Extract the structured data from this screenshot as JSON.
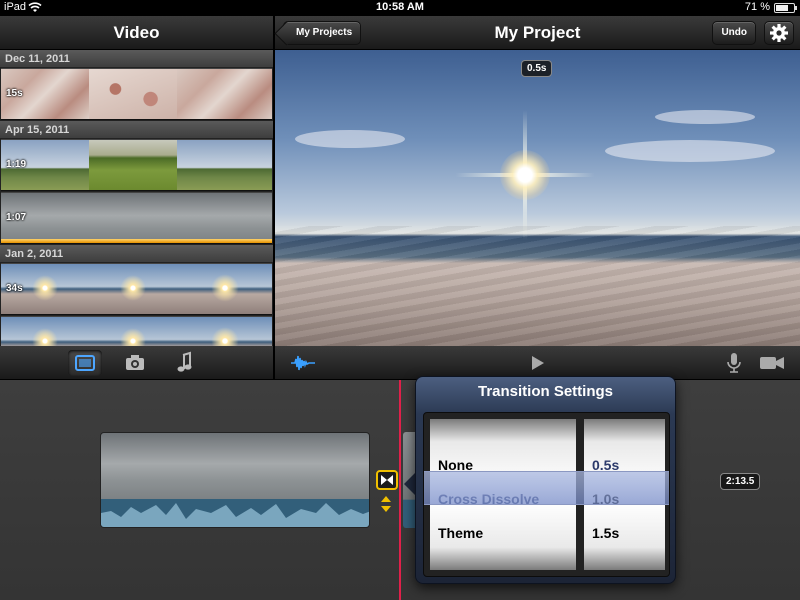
{
  "status_bar": {
    "carrier": "iPad",
    "time": "10:58 AM",
    "battery": "71 %",
    "battery_level": 0.71
  },
  "browser": {
    "title": "Video",
    "groups": [
      {
        "date": "Dec 11, 2011",
        "clips": [
          {
            "duration": "15s",
            "frames": [
              "map",
              "map2",
              "map"
            ],
            "used": false
          }
        ]
      },
      {
        "date": "Apr 15, 2011",
        "clips": [
          {
            "duration": "1:19",
            "frames": [
              "field",
              "field2",
              "field"
            ],
            "used": false
          },
          {
            "duration": "1:07",
            "frames": [
              "storm",
              "storm",
              "storm"
            ],
            "used": true
          }
        ]
      },
      {
        "date": "Jan 2, 2011",
        "clips": [
          {
            "duration": "34s",
            "frames": [
              "beach",
              "beach",
              "beach"
            ],
            "used": false
          },
          {
            "duration": "",
            "frames": [
              "beach",
              "beach",
              "beach"
            ],
            "used": false
          }
        ]
      }
    ],
    "toolbar": {
      "selected": "video-icon",
      "icons": [
        "video-icon",
        "camera-icon",
        "music-note-icon"
      ]
    }
  },
  "viewer": {
    "back_label": "My Projects",
    "title": "My Project",
    "undo_label": "Undo",
    "settings_icon": "gear-icon",
    "time_badge": "0.5s",
    "toolbar_icons": [
      "audio-waveform-icon",
      "play-icon",
      "microphone-icon",
      "video-camera-icon"
    ]
  },
  "timeline": {
    "total_duration": "2:13.5",
    "transition_icon": "transition-icon",
    "playhead_color": "#e0204a"
  },
  "transition_settings": {
    "title": "Transition Settings",
    "types": [
      "",
      "None",
      "Cross Dissolve",
      "Theme"
    ],
    "durations": [
      "",
      "",
      "0.5s",
      "1.0s",
      "1.5s"
    ],
    "selected_type": "Cross Dissolve",
    "selected_duration": "0.5s"
  },
  "colors": {
    "accent": "#f0c000",
    "selection": "#8b98c2",
    "progress": "#e69200"
  }
}
